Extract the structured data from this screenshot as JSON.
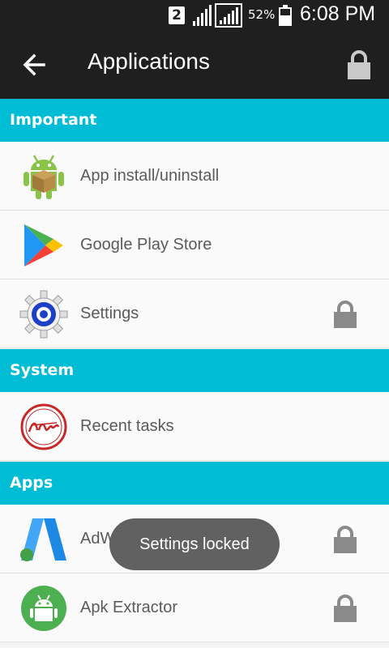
{
  "status_bar": {
    "sim_slot": "2",
    "battery_percent": "52%",
    "time": "6:08 PM",
    "icons": [
      "signal-icon",
      "signal-icon",
      "battery-icon"
    ]
  },
  "app_bar": {
    "title": "Applications",
    "back_icon": "arrow-left-icon",
    "lock_icon": "lock-icon"
  },
  "sections": [
    {
      "title": "Important",
      "items": [
        {
          "label": "App install/uninstall",
          "icon": "android-package-icon",
          "locked": false
        },
        {
          "label": "Google Play Store",
          "icon": "play-store-icon",
          "locked": false
        },
        {
          "label": "Settings",
          "icon": "settings-gear-icon",
          "locked": true
        }
      ]
    },
    {
      "title": "System",
      "items": [
        {
          "label": "Recent tasks",
          "icon": "android-badge-icon",
          "locked": false
        }
      ]
    },
    {
      "title": "Apps",
      "items": [
        {
          "label": "AdWords",
          "icon": "adwords-icon",
          "locked": true
        },
        {
          "label": "Apk Extractor",
          "icon": "apk-extractor-icon",
          "locked": true
        }
      ]
    }
  ],
  "toast": {
    "message": "Settings locked"
  },
  "colors": {
    "accent": "#00bcd4",
    "bar": "#1f1f1f",
    "toast": "#616161",
    "lock": "#8a8a8a"
  }
}
